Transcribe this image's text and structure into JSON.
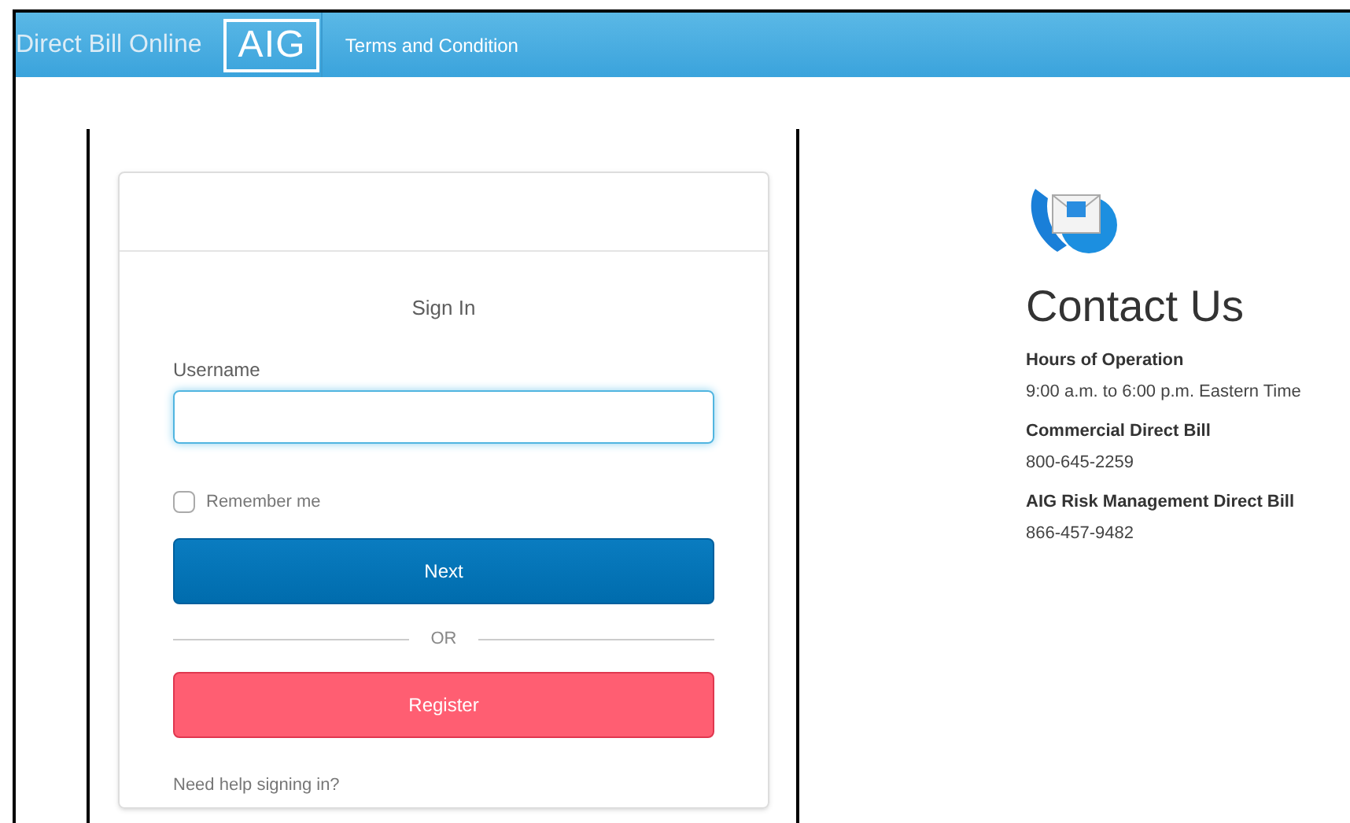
{
  "header": {
    "brand": "Direct Bill Online",
    "logo": "AIG",
    "nav": [
      "Terms and Condition"
    ]
  },
  "sign_in": {
    "title": "Sign In",
    "username": {
      "label": "Username",
      "focused": true
    },
    "remember_me": {
      "label": "Remember me",
      "checked": false
    },
    "next_button": "Next",
    "divider": "OR",
    "register_button": "Register",
    "help_link": "Need help signing in?"
  },
  "contact": {
    "title": "Contact Us",
    "sections": [
      {
        "heading": "Hours of Operation",
        "text": "9:00 a.m. to 6:00 p.m. Eastern Time"
      },
      {
        "heading": "Commercial Direct Bill",
        "text": "800-645-2259"
      },
      {
        "heading": "AIG Risk Management Direct Bill",
        "text": "866-457-9482"
      }
    ]
  }
}
